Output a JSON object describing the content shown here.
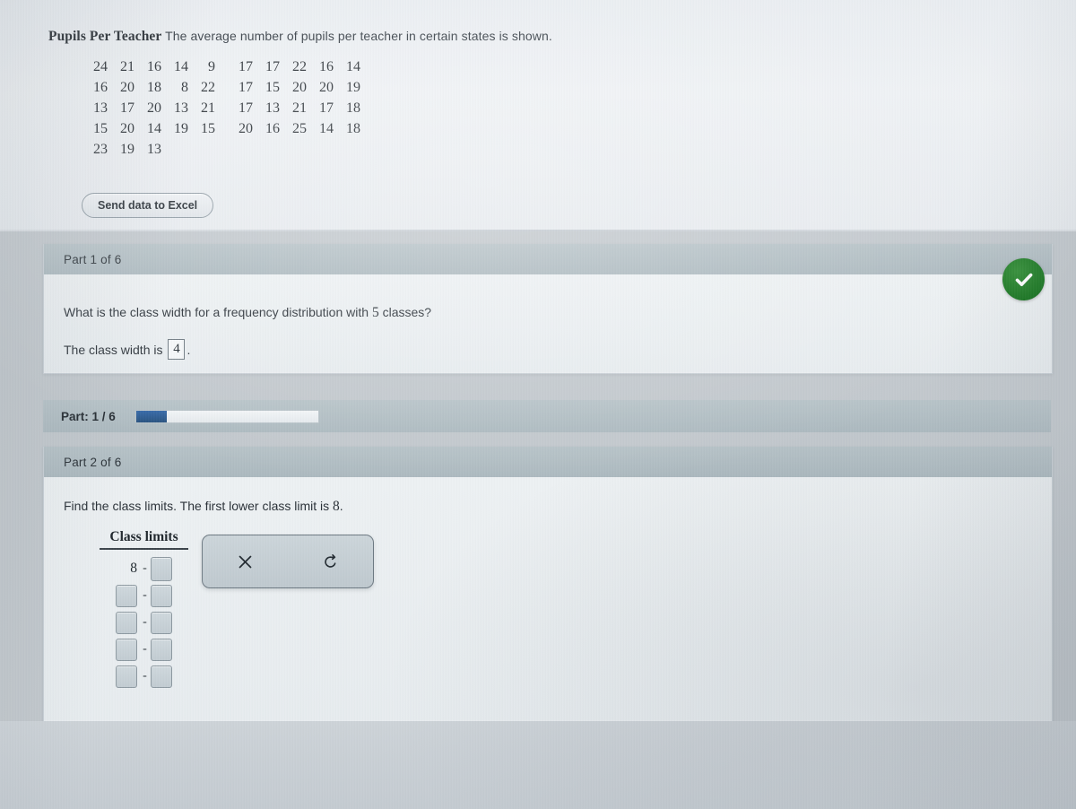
{
  "problem": {
    "title_bold": "Pupils Per Teacher",
    "title_rest": " The average number of pupils per teacher in certain states is shown.",
    "data_rows": [
      [
        "24",
        "21",
        "16",
        "14",
        "9",
        "17",
        "17",
        "22",
        "16",
        "14"
      ],
      [
        "16",
        "20",
        "18",
        "8",
        "22",
        "17",
        "15",
        "20",
        "20",
        "19"
      ],
      [
        "13",
        "17",
        "20",
        "13",
        "21",
        "17",
        "13",
        "21",
        "17",
        "18"
      ],
      [
        "15",
        "20",
        "14",
        "19",
        "15",
        "20",
        "16",
        "25",
        "14",
        "18"
      ],
      [
        "23",
        "19",
        "13",
        "",
        "",
        "",
        "",
        "",
        "",
        ""
      ]
    ],
    "excel_button": "Send data to Excel"
  },
  "part1": {
    "header": "Part 1 of 6",
    "question_prefix": "What is the class width for a frequency distribution with ",
    "question_number": "5",
    "question_suffix": " classes?",
    "answer_prefix": "The class width is",
    "answer_value": "4",
    "answer_suffix": ".",
    "status_icon": "check-circle-icon",
    "status_color": "#157a1c"
  },
  "progress": {
    "label": "Part: 1 / 6",
    "percent": 17,
    "fill_color": "#2d5f9e"
  },
  "part2": {
    "header": "Part 2 of 6",
    "question_prefix": "Find the class limits. The first lower class limit is ",
    "question_number": "8",
    "question_suffix": ".",
    "table_title": "Class limits",
    "rows": [
      {
        "lower": "8",
        "lower_is_input": false,
        "dash": "-",
        "upper": "",
        "upper_is_input": true
      },
      {
        "lower": "",
        "lower_is_input": true,
        "dash": "-",
        "upper": "",
        "upper_is_input": true
      },
      {
        "lower": "",
        "lower_is_input": true,
        "dash": "-",
        "upper": "",
        "upper_is_input": true
      },
      {
        "lower": "",
        "lower_is_input": true,
        "dash": "-",
        "upper": "",
        "upper_is_input": true
      },
      {
        "lower": "",
        "lower_is_input": true,
        "dash": "-",
        "upper": "",
        "upper_is_input": true
      }
    ]
  },
  "toolbar": {
    "clear_icon": "close-x-icon",
    "clear_label": "×",
    "undo_icon": "undo-arrow-icon",
    "undo_label": "↺"
  }
}
